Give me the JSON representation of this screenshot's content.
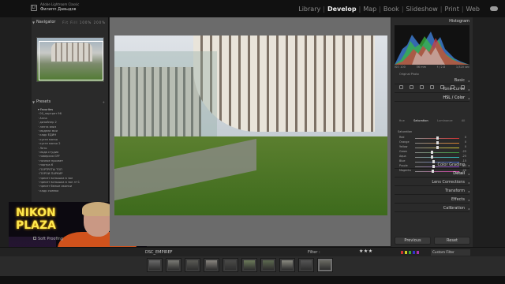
{
  "app": {
    "app_name": "Adobe Lightroom Classic",
    "catalog_name": "Филипп Давыдов",
    "logo": "Lr"
  },
  "modules": [
    {
      "label": "Library",
      "active": false
    },
    {
      "label": "Develop",
      "active": true
    },
    {
      "label": "Map",
      "active": false
    },
    {
      "label": "Book",
      "active": false
    },
    {
      "label": "Slideshow",
      "active": false
    },
    {
      "label": "Print",
      "active": false
    },
    {
      "label": "Web",
      "active": false
    }
  ],
  "navigator": {
    "title": "Navigator",
    "zoom_options": [
      "Fit",
      "Fill",
      "100%",
      "200%"
    ]
  },
  "presets": {
    "title": "Presets",
    "items": [
      "Favorites",
      "00_портрет 96",
      "Анна",
      "дизайнер 2",
      "лента вниз",
      "модели мои",
      "кадр ЕДИН",
      "кусте мягко",
      "кусте мягко 2",
      "Лето",
      "мода студия",
      "новерсия GFF",
      "ночное просвет",
      "портра 6",
      "ПОРТРЕТЫ ТОП",
      "ПОРОЙ ПАРКИР",
      "пресет вспышка в зал",
      "пресет вспышка в зал л+1",
      "пресет белые иконки",
      "кадр съемка"
    ]
  },
  "webcam": {
    "neon_line1": "NIKON",
    "neon_line2": "PLAZA"
  },
  "softproof": {
    "label": "Soft Proofing"
  },
  "histogram": {
    "title": "Histogram",
    "iso": "ISO 100",
    "focal": "56 mm",
    "aperture": "f / 2.8",
    "shutter": "1/320 sec",
    "original_photo": "Original Photo"
  },
  "sections": [
    {
      "label": "Basic",
      "active": false
    },
    {
      "label": "Tone Curve",
      "active": false
    },
    {
      "label": "HSL / Color",
      "active": true
    }
  ],
  "hsl": {
    "tabs": [
      {
        "label": "Hue",
        "on": false
      },
      {
        "label": "Saturation",
        "on": true
      },
      {
        "label": "Luminance",
        "on": false
      },
      {
        "label": "All",
        "on": false
      }
    ],
    "group_label": "Saturation",
    "rows": [
      {
        "label": "Red",
        "value": "0",
        "color": "#c33"
      },
      {
        "label": "Orange",
        "value": "0",
        "color": "#d8802a"
      },
      {
        "label": "Yellow",
        "value": "0",
        "color": "#d5c42a"
      },
      {
        "label": "Green",
        "value": "-25",
        "color": "#3a9a3a"
      },
      {
        "label": "Aqua",
        "value": "-25",
        "color": "#2ab3b3"
      },
      {
        "label": "Blue",
        "value": "-15",
        "color": "#3d5fcc"
      },
      {
        "label": "Purple",
        "value": "-15",
        "color": "#8a3acc"
      },
      {
        "label": "Magenta",
        "value": "-20",
        "color": "#cc3aa0"
      }
    ]
  },
  "lower_sections": [
    {
      "label": "Color Grading",
      "active": false
    },
    {
      "label": "Detail",
      "active": true
    },
    {
      "label": "Lens Corrections",
      "active": false
    },
    {
      "label": "Transform",
      "active": false
    },
    {
      "label": "Effects",
      "active": false
    },
    {
      "label": "Calibration",
      "active": false
    }
  ],
  "buttons": {
    "previous": "Previous",
    "reset": "Reset"
  },
  "filmbar": {
    "folder": "DSC_EMPIREF",
    "filter_label": "Filter :",
    "stars": "★★★",
    "custom_filter": "Custom Filter",
    "flag_colors": [
      "#c33",
      "#cc2",
      "#3a3",
      "#33c",
      "#a3a"
    ]
  },
  "thumbnails": [
    {
      "color": "#6a6a6a"
    },
    {
      "color": "#7a7a75"
    },
    {
      "color": "#5a5a55"
    },
    {
      "color": "#8a8680"
    },
    {
      "color": "#4a4a48"
    },
    {
      "color": "#6c7a5a"
    },
    {
      "color": "#5d6a50"
    },
    {
      "color": "#8a8a80"
    },
    {
      "color": "#555"
    },
    {
      "color": "#6a6a62"
    }
  ]
}
